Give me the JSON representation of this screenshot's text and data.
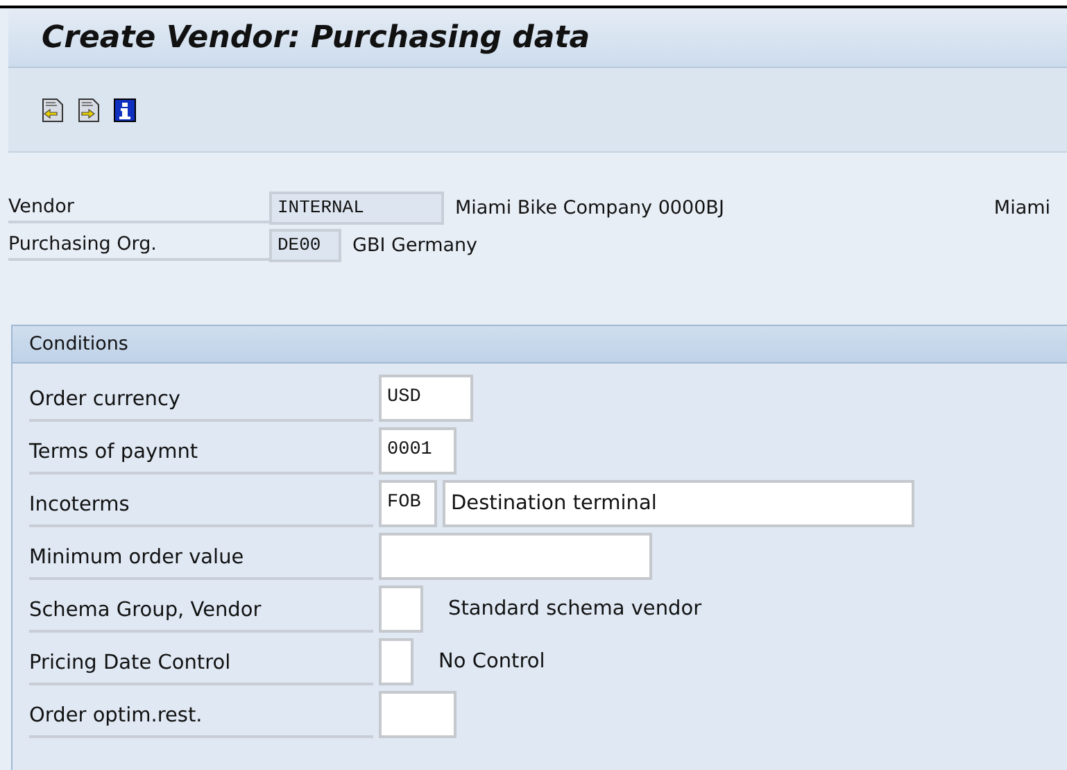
{
  "window": {
    "title": "Create Vendor: Purchasing data"
  },
  "header_fields": [
    {
      "label": "Vendor",
      "value": "INTERNAL",
      "description": "Miami Bike Company 0000BJ",
      "city": "Miami"
    },
    {
      "label": "Purchasing Org.",
      "value": "DE00",
      "description": "GBI Germany"
    }
  ],
  "conditions": {
    "title": "Conditions",
    "rows": [
      {
        "label": "Order currency",
        "fields": [
          {
            "value": "USD"
          }
        ]
      },
      {
        "label": "Terms of paymnt",
        "fields": [
          {
            "value": "0001"
          }
        ]
      },
      {
        "label": "Incoterms",
        "fields": [
          {
            "value": "FOB"
          },
          {
            "value": "Destination terminal"
          }
        ]
      },
      {
        "label": "Minimum order value"
      },
      {
        "label": "Schema Group, Vendor",
        "description": "Standard schema vendor"
      },
      {
        "label": "Pricing Date Control",
        "description": "No Control"
      },
      {
        "label": "Order optim.rest."
      }
    ]
  }
}
